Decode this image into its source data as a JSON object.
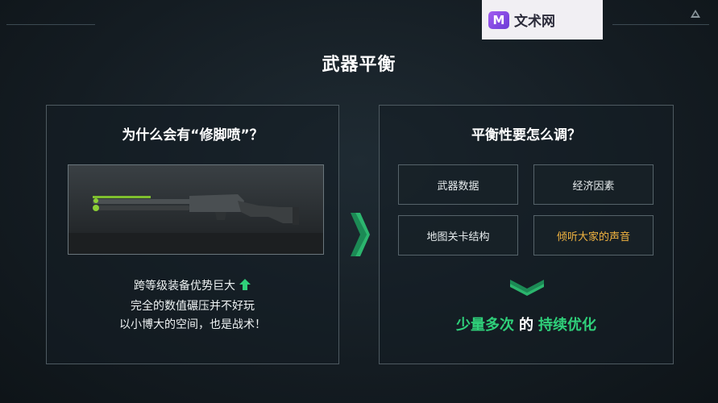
{
  "watermark": {
    "logo_letter": "M",
    "text": "文术网"
  },
  "slide": {
    "title": "武器平衡"
  },
  "left_panel": {
    "title": "为什么会有“修脚喷”？",
    "image_icon": "shotgun-image",
    "lines": [
      "跨等级装备优势巨大",
      "完全的数值碾压并不好玩",
      "以小博大的空间，也是战术！"
    ],
    "arrow_icon": "green-up-arrow-icon"
  },
  "right_panel": {
    "title": "平衡性要怎么调？",
    "items": [
      "武器数据",
      "经济因素",
      "地图关卡结构",
      "倾听大家的声音"
    ],
    "phrase_part1": "少量多次",
    "phrase_part2": "的",
    "phrase_part3": "持续优化"
  },
  "colors": {
    "accent_green": "#2fd07a",
    "highlight_orange": "#f2b440",
    "border": "#4e5a61"
  }
}
